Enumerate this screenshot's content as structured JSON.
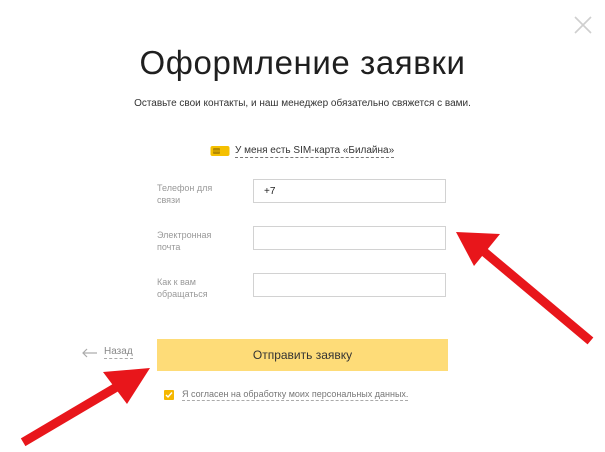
{
  "dialog": {
    "title": "Оформление заявки",
    "subtitle": "Оставьте свои контакты, и наш менеджер обязательно свяжется с вами.",
    "sim_link": "У меня есть SIM-карта «Билайна»"
  },
  "form": {
    "phone_label": "Телефон для связи",
    "phone_value": "+7",
    "email_label": "Электронная почта",
    "email_value": "",
    "name_label": "Как к вам обращаться",
    "name_value": ""
  },
  "actions": {
    "back_label": "Назад",
    "submit_label": "Отправить заявку",
    "consent_label": "Я согласен на обработку моих персональных данных.",
    "consent_checked": true
  },
  "colors": {
    "accent": "#fedc78",
    "checkbox": "#f5b700",
    "annotation_arrow": "#e8161b"
  },
  "icons": [
    "close-icon",
    "sim-card-icon",
    "arrow-left-icon",
    "checkmark-icon",
    "annotation-arrow"
  ]
}
